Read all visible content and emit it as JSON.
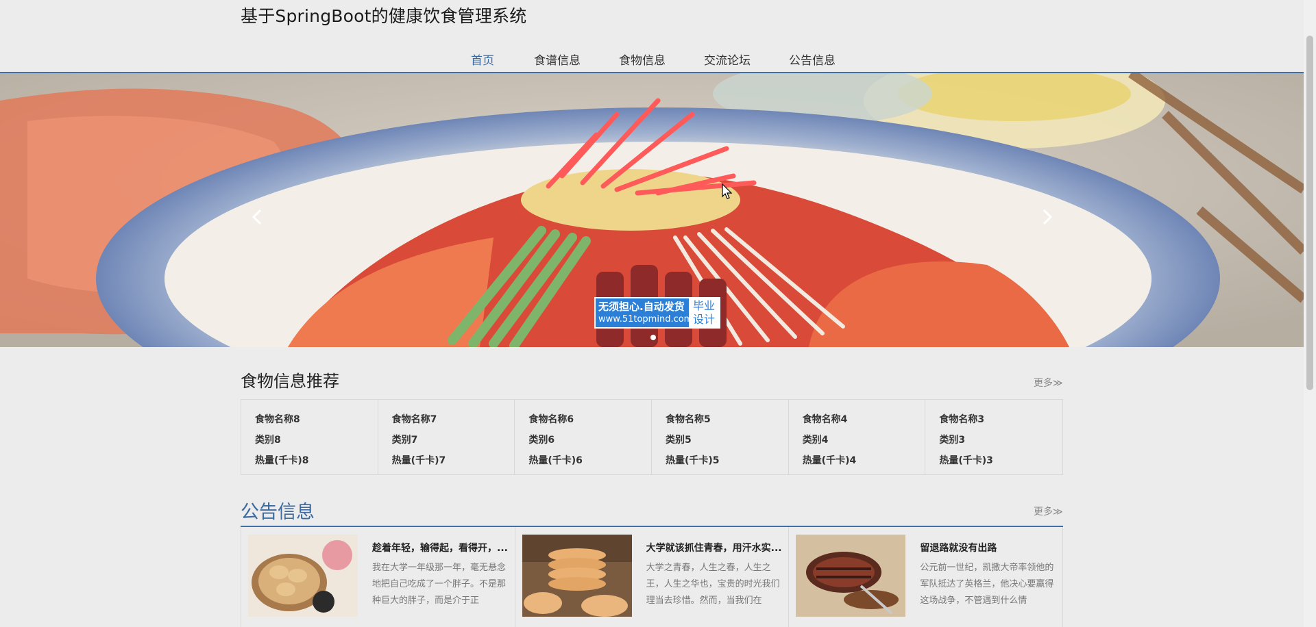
{
  "header": {
    "site_title": "基于SpringBoot的健康饮食管理系统",
    "nav": [
      {
        "label": "首页",
        "active": true
      },
      {
        "label": "食谱信息",
        "active": false
      },
      {
        "label": "食物信息",
        "active": false
      },
      {
        "label": "交流论坛",
        "active": false
      },
      {
        "label": "公告信息",
        "active": false
      }
    ]
  },
  "banner": {
    "watermark_line1": "无须担心.自动发货",
    "watermark_line2": "www.51topmind.com",
    "watermark_badge_top": "毕业",
    "watermark_badge_bottom": "设计",
    "slide_count": 1,
    "active_slide": 0
  },
  "food_section": {
    "title": "食物信息推荐",
    "more": "更多≫",
    "cards": [
      {
        "name": "食物名称8",
        "category": "类别8",
        "calories": "热量(千卡)8"
      },
      {
        "name": "食物名称7",
        "category": "类别7",
        "calories": "热量(千卡)7"
      },
      {
        "name": "食物名称6",
        "category": "类别6",
        "calories": "热量(千卡)6"
      },
      {
        "name": "食物名称5",
        "category": "类别5",
        "calories": "热量(千卡)5"
      },
      {
        "name": "食物名称4",
        "category": "类别4",
        "calories": "热量(千卡)4"
      },
      {
        "name": "食物名称3",
        "category": "类别3",
        "calories": "热量(千卡)3"
      }
    ]
  },
  "notice_section": {
    "title": "公告信息",
    "more": "更多≫",
    "items": [
      {
        "title": "趁着年轻，输得起，看得开，...",
        "summary": "我在大学一年级那一年，毫无悬念地把自己吃成了一个胖子。不是那种巨大的胖子，而是介于正",
        "thumb": "sandwich-plate"
      },
      {
        "title": "大学就该抓住青春，用汗水实...",
        "summary": "大学之青春，人生之春，人生之王，人生之华也，宝贵的时光我们理当去珍惜。然而，当我们在",
        "thumb": "pancake-stack"
      },
      {
        "title": "留退路就没有出路",
        "summary": "公元前一世纪，凯撒大帝率领他的军队抵达了英格兰，他决心要赢得这场战争，不管遇到什么情",
        "thumb": "steak"
      }
    ]
  },
  "colors": {
    "accent": "#3b6aa0",
    "rule": "#3f6fa5",
    "watermark_blue": "#2b7fd6",
    "page_bg": "#ececec"
  }
}
